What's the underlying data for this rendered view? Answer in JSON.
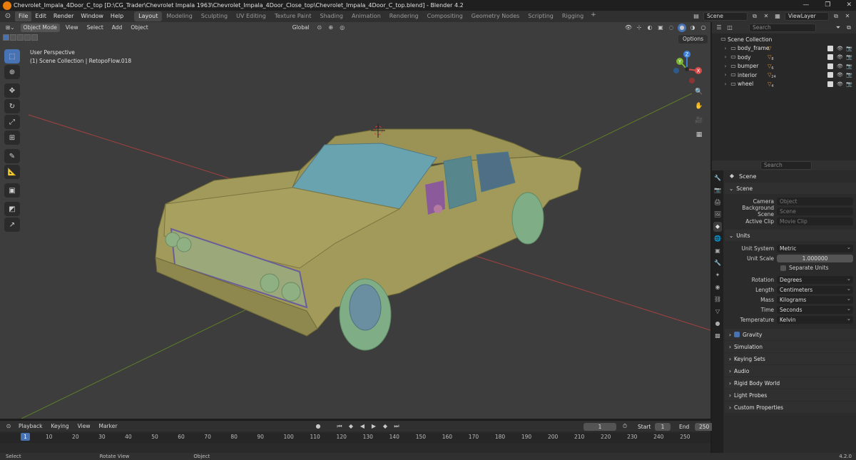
{
  "window": {
    "title": "Chevrolet_Impala_4Door_C_top [D:\\CG_Trader\\Chevrolet Impala 1963\\Chevrolet_Impala_4Door_Close_top\\Chevrolet_Impala_4Door_C_top.blend] - Blender 4.2",
    "minimize": "—",
    "maximize": "❐",
    "close": "✕"
  },
  "menu": {
    "items": [
      "File",
      "Edit",
      "Render",
      "Window",
      "Help"
    ],
    "workspaces": [
      "Layout",
      "Modeling",
      "Sculpting",
      "UV Editing",
      "Texture Paint",
      "Shading",
      "Animation",
      "Rendering",
      "Compositing",
      "Geometry Nodes",
      "Scripting",
      "Rigging"
    ],
    "add_workspace": "+",
    "scene_field": "Scene",
    "viewlayer_field": "ViewLayer"
  },
  "viewport": {
    "mode": "Object Mode",
    "menus": [
      "View",
      "Select",
      "Add",
      "Object"
    ],
    "orientation": "Global",
    "options": "Options",
    "info_line1": "User Perspective",
    "info_line2": "(1) Scene Collection | RetopoFlow.018",
    "gizmo": {
      "x": "X",
      "y": "Y",
      "z": "Z"
    }
  },
  "timeline": {
    "menus": [
      "Playback",
      "Keying",
      "View",
      "Marker"
    ],
    "current_frame": "1",
    "start_label": "Start",
    "start": "1",
    "end_label": "End",
    "end": "250",
    "ticks": [
      "10",
      "20",
      "30",
      "40",
      "50",
      "60",
      "70",
      "80",
      "90",
      "100",
      "110",
      "120",
      "130",
      "140",
      "150",
      "160",
      "170",
      "180",
      "190",
      "200",
      "210",
      "220",
      "230",
      "240",
      "250"
    ],
    "cursor": "1"
  },
  "status": {
    "select": "Select",
    "rotate": "Rotate View",
    "object": "Object",
    "version": "4.2.0"
  },
  "outliner": {
    "search_placeholder": "Search",
    "root": "Scene Collection",
    "items": [
      {
        "name": "body_frame",
        "count": ""
      },
      {
        "name": "body",
        "count": "8"
      },
      {
        "name": "bumper",
        "count": "6"
      },
      {
        "name": "interior",
        "count": "24"
      },
      {
        "name": "wheel",
        "count": "4"
      }
    ]
  },
  "properties": {
    "search_placeholder": "Search",
    "context": "Scene",
    "scene_panel": "Scene",
    "camera_label": "Camera",
    "camera_placeholder": "Object",
    "bg_scene_label": "Background Scene",
    "bg_scene_placeholder": "Scene",
    "active_clip_label": "Active Clip",
    "active_clip_placeholder": "Movie Clip",
    "units_panel": "Units",
    "unit_system_label": "Unit System",
    "unit_system": "Metric",
    "unit_scale_label": "Unit Scale",
    "unit_scale": "1.000000",
    "separate_units": "Separate Units",
    "rotation_label": "Rotation",
    "rotation": "Degrees",
    "length_label": "Length",
    "length": "Centimeters",
    "mass_label": "Mass",
    "mass": "Kilograms",
    "time_label": "Time",
    "time": "Seconds",
    "temperature_label": "Temperature",
    "temperature": "Kelvin",
    "collapsed_panels": [
      "Gravity",
      "Simulation",
      "Keying Sets",
      "Audio",
      "Rigid Body World",
      "Light Probes",
      "Custom Properties"
    ]
  },
  "colors": {
    "accent": "#4772b3",
    "viewport_bg": "#3d3d3d",
    "car_body": "#a29a5a",
    "glass": "#6aa3b0",
    "wheel": "#7fae86",
    "axis_x": "#b0403f",
    "axis_y": "#6a8a2a"
  }
}
